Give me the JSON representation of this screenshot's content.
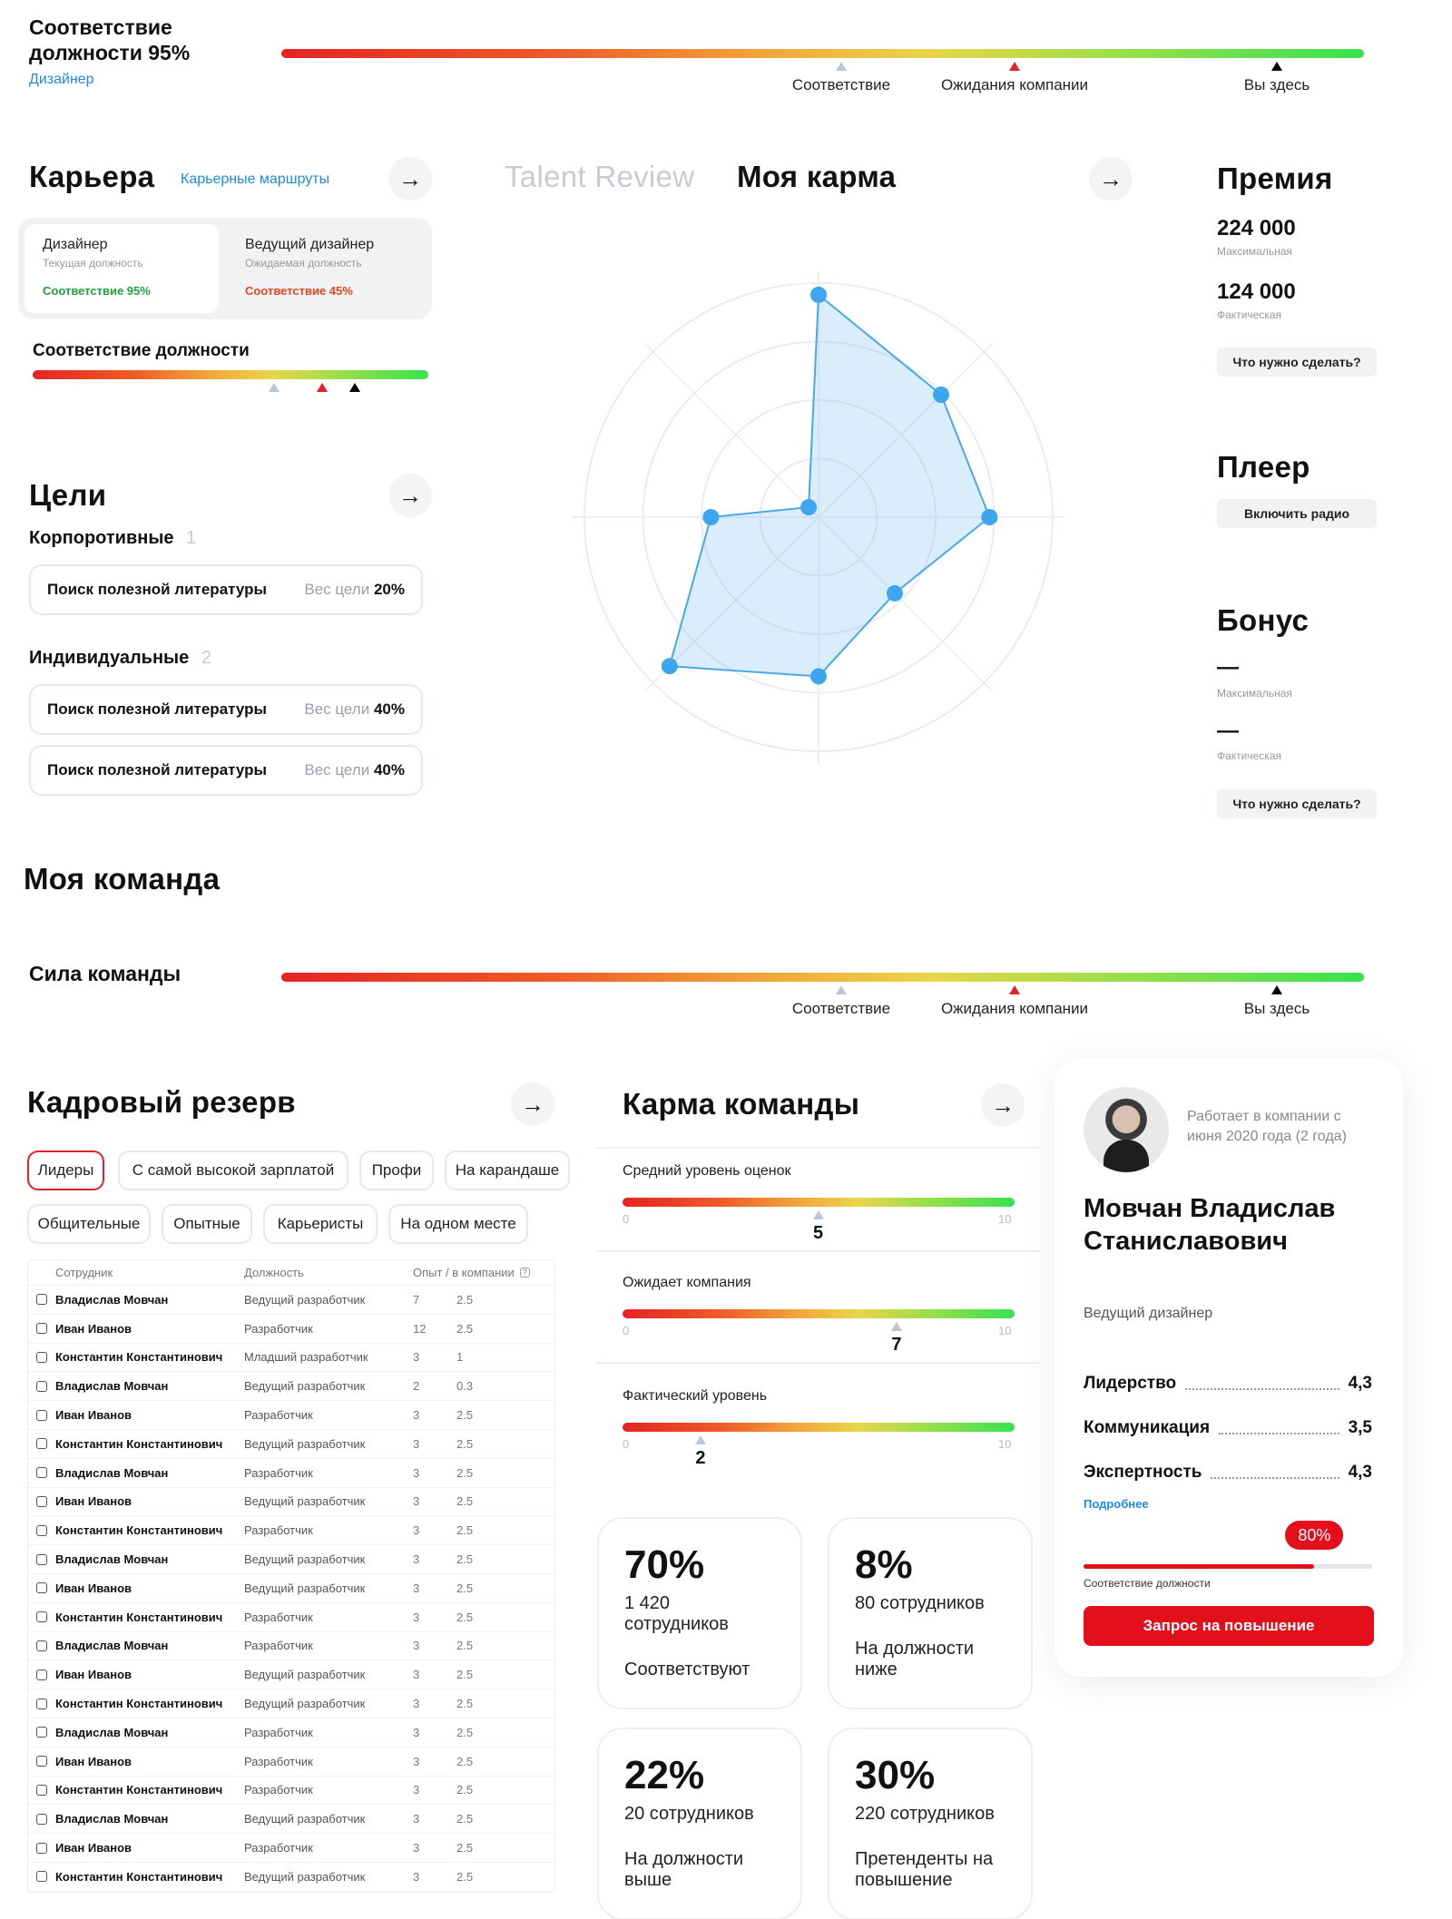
{
  "top": {
    "title": "Соответствие должности 95%",
    "subtitle": "Дизайнер",
    "markers": [
      "Соответствие",
      "Ожидания компании",
      "Вы здесь"
    ]
  },
  "career": {
    "title": "Карьера",
    "link": "Карьерные маршруты",
    "current": {
      "title": "Дизайнер",
      "sub": "Текущая должность",
      "match": "Соответствие 95%"
    },
    "expected": {
      "title": "Ведущий дизайнер",
      "sub": "Ожидаемая должность",
      "match": "Соответствие 45%"
    },
    "fit_title": "Соответствие должности"
  },
  "goals": {
    "title": "Цели",
    "corporate": {
      "label": "Корпоротивные",
      "count": "1"
    },
    "individual": {
      "label": "Индивидуальные",
      "count": "2"
    },
    "weight_label": "Вес цели",
    "items": [
      {
        "name": "Поиск полезной литературы",
        "weight": "20%"
      },
      {
        "name": "Поиск полезной литературы",
        "weight": "40%"
      },
      {
        "name": "Поиск полезной литературы",
        "weight": "40%"
      }
    ]
  },
  "karma": {
    "tab_inactive": "Talent Review",
    "tab_active": "Моя карма",
    "radar_values": [
      0.95,
      0.74,
      0.73,
      0.46,
      0.68,
      0.9,
      0.46,
      0.06
    ]
  },
  "bonus": {
    "premium_title": "Премия",
    "max_value": "224 000",
    "max_label": "Максимальная",
    "fact_value": "124 000",
    "fact_label": "Фактическая",
    "todo_button": "Что нужно сделать?",
    "player_title": "Плеер",
    "radio_button": "Включить радио",
    "bonus_title": "Бонус",
    "bonus_max_value": "—",
    "bonus_fact_value": "—"
  },
  "team": {
    "title": "Моя команда",
    "strength_title": "Сила команды"
  },
  "reserve": {
    "title": "Кадровый резерв",
    "chips": [
      "Лидеры",
      "С самой высокой зарплатой",
      "Профи",
      "На карандаше",
      "Общительные",
      "Опытные",
      "Карьеристы",
      "На одном месте"
    ],
    "columns": [
      "Сотрудник",
      "Должность",
      "Опыт / в компании"
    ],
    "rows": [
      [
        "Владислав Мовчан",
        "Ведущий разработчик",
        "7",
        "2.5"
      ],
      [
        "Иван Иванов",
        "Разработчик",
        "12",
        "2.5"
      ],
      [
        "Константин Константинович",
        "Младший разработчик",
        "3",
        "1"
      ],
      [
        "Владислав Мовчан",
        "Ведущий разработчик",
        "2",
        "0.3"
      ],
      [
        "Иван Иванов",
        "Разработчик",
        "3",
        "2.5"
      ],
      [
        "Константин Константинович",
        "Ведущий разработчик",
        "3",
        "2.5"
      ],
      [
        "Владислав Мовчан",
        "Разработчик",
        "3",
        "2.5"
      ],
      [
        "Иван Иванов",
        "Ведущий разработчик",
        "3",
        "2.5"
      ],
      [
        "Константин Константинович",
        "Разработчик",
        "3",
        "2.5"
      ],
      [
        "Владислав Мовчан",
        "Ведущий разработчик",
        "3",
        "2.5"
      ],
      [
        "Иван Иванов",
        "Ведущий разработчик",
        "3",
        "2.5"
      ],
      [
        "Константин Константинович",
        "Разработчик",
        "3",
        "2.5"
      ],
      [
        "Владислав Мовчан",
        "Разработчик",
        "3",
        "2.5"
      ],
      [
        "Иван Иванов",
        "Ведущий разработчик",
        "3",
        "2.5"
      ],
      [
        "Константин Константинович",
        "Ведущий разработчик",
        "3",
        "2.5"
      ],
      [
        "Владислав Мовчан",
        "Разработчик",
        "3",
        "2.5"
      ],
      [
        "Иван Иванов",
        "Разработчик",
        "3",
        "2.5"
      ],
      [
        "Константин Константинович",
        "Разработчик",
        "3",
        "2.5"
      ],
      [
        "Владислав Мовчан",
        "Ведущий разработчик",
        "3",
        "2.5"
      ],
      [
        "Иван Иванов",
        "Разработчик",
        "3",
        "2.5"
      ],
      [
        "Константин Константинович",
        "Ведущий разработчик",
        "3",
        "2.5"
      ]
    ]
  },
  "team_karma": {
    "title": "Карма команды",
    "scale_min": "0",
    "scale_max": "10",
    "rows": [
      {
        "label": "Средний уровень оценок",
        "value": "5"
      },
      {
        "label": "Ожидает компания",
        "value": "7"
      },
      {
        "label": "Фактический уровень",
        "value": "2"
      }
    ],
    "cards": [
      {
        "percent": "70%",
        "count": "1 420 сотрудников",
        "label": "Соответствуют"
      },
      {
        "percent": "8%",
        "count": "80 сотрудников",
        "label": "На должности ниже"
      },
      {
        "percent": "22%",
        "count": "20 сотрудников",
        "label": "На должности выше"
      },
      {
        "percent": "30%",
        "count": "220 сотрудников",
        "label": "Претенденты на повышение"
      }
    ]
  },
  "profile": {
    "tenure": "Работает в компании с июня 2020 года (2 года)",
    "name": "Мовчан Владислав Станиславович",
    "position": "Ведущий дизайнер",
    "skills": [
      {
        "name": "Лидерство",
        "value": "4,3"
      },
      {
        "name": "Коммуникация",
        "value": "3,5"
      },
      {
        "name": "Экспертность",
        "value": "4,3"
      }
    ],
    "more_link": "Подробнее",
    "fit_percent": "80%",
    "fit_value": 0.8,
    "fit_label": "Соответствие должности",
    "promo_button": "Запрос на повышение",
    "accent": "#e3101c"
  }
}
